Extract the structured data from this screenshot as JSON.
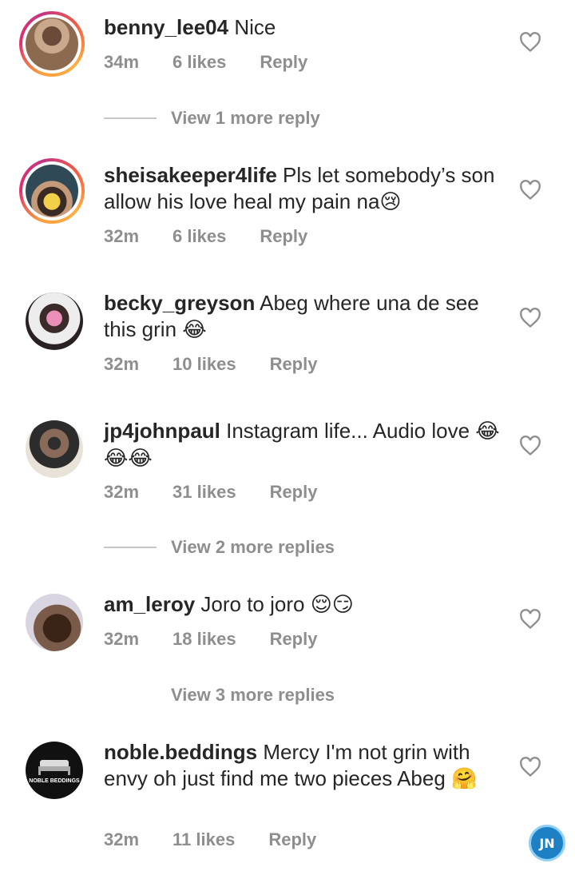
{
  "comments": [
    {
      "username": "benny_lee04",
      "text": " Nice",
      "time": "34m",
      "likes": "6 likes",
      "reply": "Reply",
      "view_more": "View 1 more reply"
    },
    {
      "username": "sheisakeeper4life",
      "text": " Pls let somebody’s son allow his love heal my pain na",
      "emoji": "😢",
      "time": "32m",
      "likes": "6 likes",
      "reply": "Reply"
    },
    {
      "username": "becky_greyson",
      "text": " Abeg where una de see this grin ",
      "emoji": "😂",
      "time": "32m",
      "likes": "10 likes",
      "reply": "Reply"
    },
    {
      "username": "jp4johnpaul",
      "text": " Instagram life... Audio love ",
      "emoji": "😂😂😂",
      "time": "32m",
      "likes": "31 likes",
      "reply": "Reply",
      "view_more": "View 2 more replies"
    },
    {
      "username": "am_leroy",
      "text": " Joro to joro ",
      "emoji": "😌😏",
      "time": "32m",
      "likes": "18 likes",
      "reply": "Reply",
      "view_more": "View 3 more replies"
    },
    {
      "username": "noble.beddings",
      "text": " Mercy I'm not grin with envy oh just find me two pieces Abeg ",
      "emoji": "🤗",
      "time": "32m",
      "likes": "11 likes",
      "reply": "Reply",
      "avatar_label": "NOBLE BEDDINGS"
    }
  ],
  "watermark": "JN",
  "colors": {
    "text": "#262626",
    "meta": "#8e8e8e",
    "heart": "#8e8e8e",
    "story_ring": "#e1306c"
  }
}
